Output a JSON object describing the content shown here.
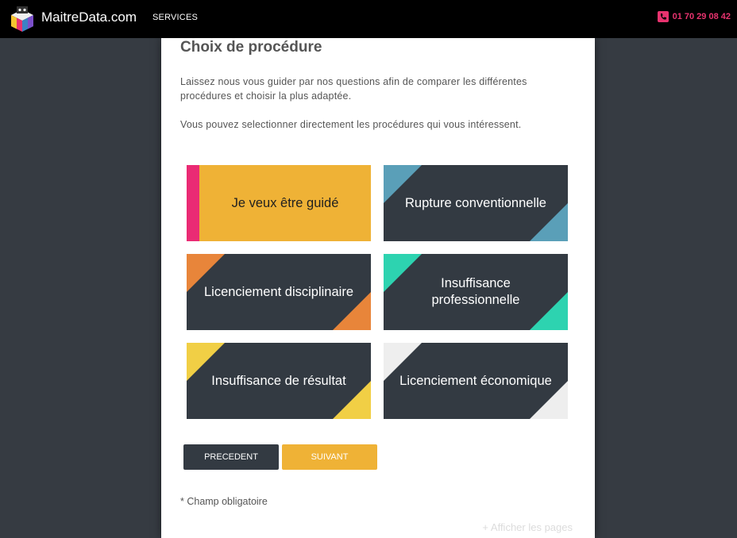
{
  "header": {
    "brand": "MaitreData.com",
    "nav_services": "SERVICES",
    "phone": "01 70 29 08 42"
  },
  "main": {
    "title": "Choix de procédure",
    "intro_paragraph": "Laissez nous vous guider par nos questions afin de comparer les différentes procédures et choisir la plus adaptée.",
    "intro_paragraph_2": "Vous pouvez selectionner directement les procédures qui vous intéressent.",
    "options": [
      {
        "label": "Je veux être guidé",
        "selected": true,
        "accent": "#ea2b74"
      },
      {
        "label": "Rupture conventionnelle",
        "selected": false,
        "accent": "#5a9fb8"
      },
      {
        "label": "Licenciement disciplinaire",
        "selected": false,
        "accent": "#e8853a"
      },
      {
        "label": "Insuffisance professionnelle",
        "selected": false,
        "accent": "#2dd3b0"
      },
      {
        "label": "Insuffisance de résultat",
        "selected": false,
        "accent": "#f1cf45"
      },
      {
        "label": "Licenciement économique",
        "selected": false,
        "accent": "#eeeeee"
      }
    ],
    "buttons": {
      "prev": "PRECEDENT",
      "next": "SUIVANT"
    },
    "required_note": "* Champ obligatoire",
    "show_pages": "+ Afficher les pages"
  },
  "colors": {
    "background": "#363b42",
    "tile_dark": "#333a42",
    "selected": "#efb236",
    "phone_accent": "#e8336f"
  },
  "icons": {
    "logo": "cube-logo-icon",
    "phone": "phone-icon"
  }
}
